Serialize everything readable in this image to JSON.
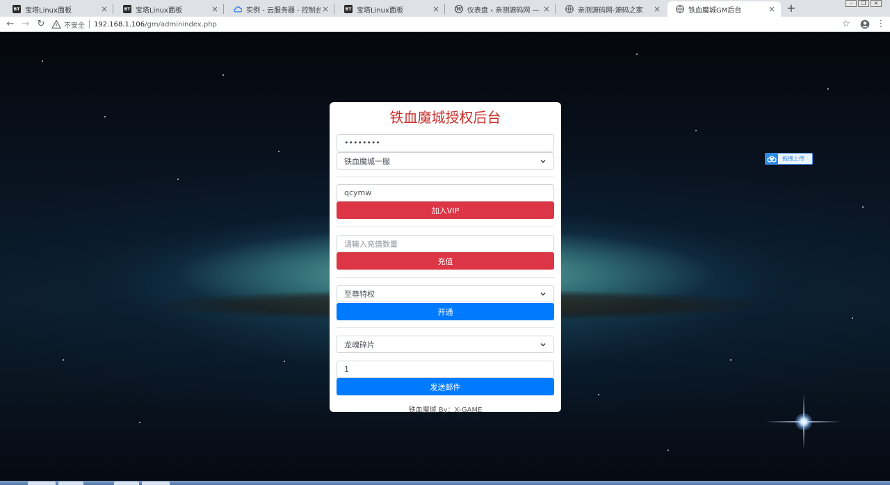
{
  "browser": {
    "tabs": [
      {
        "title": "宝塔Linux面板",
        "icon": "bt-icon"
      },
      {
        "title": "宝塔Linux面板",
        "icon": "bt-icon"
      },
      {
        "title": "实例 - 云服务器 - 控制台",
        "icon": "cloud-icon"
      },
      {
        "title": "宝塔Linux面板",
        "icon": "bt-icon"
      },
      {
        "title": "仪表盘 ‹ 亲测源码网 — WordPr",
        "icon": "wordpress-icon"
      },
      {
        "title": "亲测源码网-源码之家",
        "icon": "globe-icon"
      },
      {
        "title": "铁血魔城GM后台",
        "icon": "globe-icon",
        "active": true
      }
    ],
    "security_label": "不安全",
    "url_host": "192.168.1.106",
    "url_path": "/gm/adminindex.php"
  },
  "upload_badge": {
    "label": "拖拽上传"
  },
  "form": {
    "title": "铁血魔城授权后台",
    "password_value": "••••••••",
    "server_select": "铁血魔城一服",
    "account_value": "qcymw",
    "vip_button": "加入VIP",
    "recharge_placeholder": "请输入充值数量",
    "recharge_button": "充值",
    "privilege_select": "至尊特权",
    "activate_button": "开通",
    "item_select": "龙魂碎片",
    "quantity_value": "1",
    "mail_button": "发送邮件",
    "footer": "铁血魔城 By：X-GAME"
  },
  "colors": {
    "title_red": "#c9302c",
    "danger": "#dc3545",
    "primary": "#007bff"
  }
}
